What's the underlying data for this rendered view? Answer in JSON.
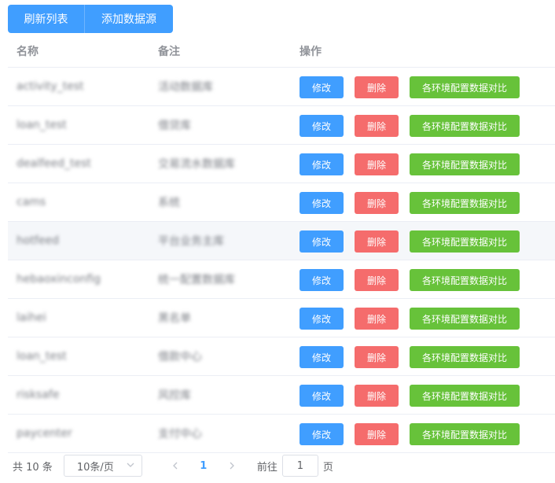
{
  "toolbar": {
    "refresh_label": "刷新列表",
    "add_label": "添加数据源"
  },
  "table": {
    "headers": {
      "name": "名称",
      "note": "备注",
      "ops": "操作"
    },
    "rows": [
      {
        "name": "activity_test",
        "note": "活动数据库"
      },
      {
        "name": "loan_test",
        "note": "借贷库"
      },
      {
        "name": "dealfeed_test",
        "note": "交易流水数据库"
      },
      {
        "name": "cams",
        "note": "系统"
      },
      {
        "name": "hotfeed",
        "note": "平台业务主库"
      },
      {
        "name": "hebaoxinconfig",
        "note": "统一配置数据库"
      },
      {
        "name": "laihei",
        "note": "黑名单"
      },
      {
        "name": "loan_test",
        "note": "借款中心"
      },
      {
        "name": "risksafe",
        "note": "风控库"
      },
      {
        "name": "paycenter",
        "note": "支付中心"
      }
    ],
    "row_actions": {
      "edit": "修改",
      "delete": "删除",
      "compare": "各环境配置数据对比"
    },
    "hover_row_index": 4
  },
  "pagination": {
    "total_text": "共 10 条",
    "page_size": "10条/页",
    "current_page": "1",
    "goto_prefix": "前往",
    "goto_value": "1",
    "goto_suffix": "页"
  },
  "colors": {
    "primary": "#409eff",
    "danger": "#f56c6c",
    "success": "#67c23a"
  }
}
